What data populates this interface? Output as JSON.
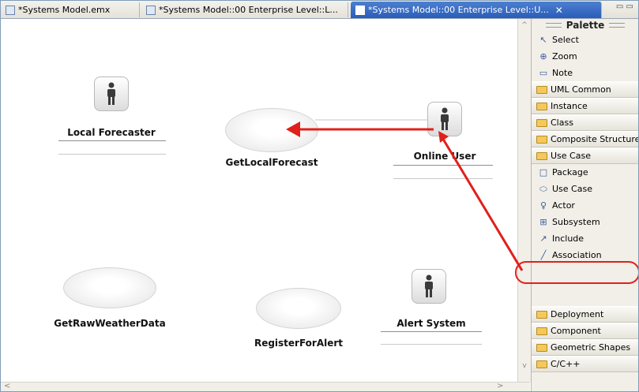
{
  "tabs": [
    {
      "label": "*Systems Model.emx",
      "active": false
    },
    {
      "label": "*Systems Model::00 Enterprise Level::L...",
      "active": false
    },
    {
      "label": "*Systems Model::00 Enterprise Level::U...",
      "active": true
    }
  ],
  "tab_close_glyph": "✕",
  "window_buttons": "▭ ▭",
  "diagram": {
    "actors": [
      {
        "name": "Local Forecaster"
      },
      {
        "name": "Online User"
      },
      {
        "name": "Alert System"
      }
    ],
    "use_cases": [
      {
        "name": "GetLocalForecast"
      },
      {
        "name": "GetRawWeatherData"
      },
      {
        "name": "RegisterForAlert"
      }
    ]
  },
  "palette": {
    "title": "Palette",
    "tools": [
      {
        "label": "Select",
        "icon": "cursor-icon"
      },
      {
        "label": "Zoom",
        "icon": "zoom-icon"
      },
      {
        "label": "Note",
        "icon": "note-icon"
      }
    ],
    "drawers_top": [
      {
        "label": "UML Common"
      },
      {
        "label": "Instance"
      },
      {
        "label": "Class"
      },
      {
        "label": "Composite Structure"
      },
      {
        "label": "Use Case"
      }
    ],
    "use_case_items": [
      {
        "label": "Package",
        "icon": "package-icon"
      },
      {
        "label": "Use Case",
        "icon": "use-case-icon"
      },
      {
        "label": "Actor",
        "icon": "actor-icon"
      },
      {
        "label": "Subsystem",
        "icon": "subsystem-icon"
      },
      {
        "label": "Include",
        "icon": "include-icon"
      },
      {
        "label": "Association",
        "icon": "association-icon"
      }
    ],
    "drawers_bottom": [
      {
        "label": "Deployment"
      },
      {
        "label": "Component"
      },
      {
        "label": "Geometric Shapes"
      },
      {
        "label": "C/C++"
      }
    ]
  },
  "colors": {
    "highlight": "#e0201b",
    "active_tab": "#2f62bf"
  }
}
